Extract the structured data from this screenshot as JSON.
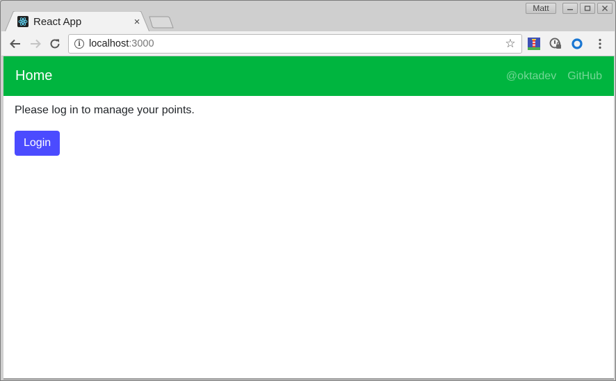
{
  "browser": {
    "tab": {
      "title": "React App",
      "favicon": "react-logo-icon",
      "close_icon": "×"
    },
    "window_controls": {
      "user_label": "Matt",
      "minimize": "–",
      "maximize": "▭",
      "close": "✕"
    },
    "toolbar": {
      "back_icon": "←",
      "forward_icon": "→",
      "reload_icon": "↻",
      "url_host": "localhost",
      "url_port": ":3000",
      "bookmark_icon": "☆",
      "extensions": [
        "lighthouse-icon",
        "password-manager-icon",
        "extension-ring-icon"
      ],
      "menu_icon": "⋮"
    }
  },
  "page": {
    "navbar": {
      "brand": "Home",
      "links": [
        "@oktadev",
        "GitHub"
      ],
      "color": "#00b53f"
    },
    "message": "Please log in to manage your points.",
    "login_button": {
      "label": "Login",
      "color": "#4b4bff"
    }
  }
}
